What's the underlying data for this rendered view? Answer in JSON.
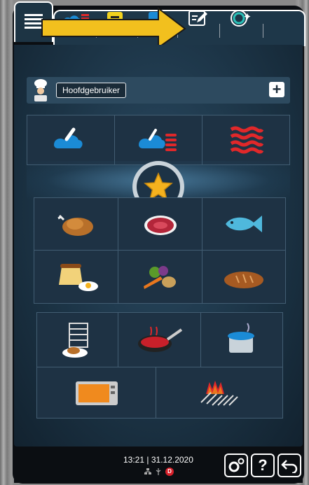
{
  "user": {
    "name": "Hoofdgebruiker",
    "add_label": "+"
  },
  "status": {
    "time": "13:21",
    "separator": "|",
    "date": "31.12.2020",
    "drive_label": "D"
  },
  "buttons": {
    "help_label": "?"
  },
  "tabs": [
    "menu-icon",
    "steam-icon",
    "combi-icon",
    "recipe-tab-icon",
    "save-tab-icon",
    "edit-icon",
    "smart-cooking-icon"
  ],
  "cooking_modes": [
    "steam-icon",
    "combi-icon",
    "hot-air-icon"
  ],
  "food_categories": [
    "poultry-icon",
    "meat-icon",
    "fish-icon",
    "egg-dessert-icon",
    "vegetables-icon",
    "bakery-icon"
  ],
  "applications": [
    "finishing-icon",
    "pan-frying-icon",
    "pot-cooking-icon",
    "oven-icon",
    "grill-icon"
  ],
  "colors": {
    "accent_steam": "#1b8bd6",
    "accent_hot_air": "#e0282a",
    "highlight_arrow": "#f2c01e",
    "background": "#1d3446"
  }
}
